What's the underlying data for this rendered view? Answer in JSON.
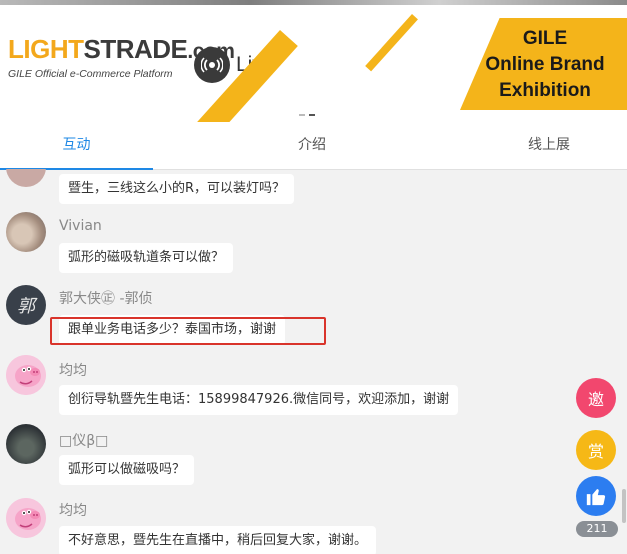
{
  "banner": {
    "logo_light": "LIGHT",
    "logo_strade": "STRADE",
    "logo_com": ".com",
    "logo_tagline": "GILE Official e-Commerce Platform",
    "live_label": "Live",
    "exhibition_lines": [
      "GILE",
      "Online Brand",
      "Exhibition"
    ]
  },
  "tabs": [
    {
      "label": "互动",
      "active": true
    },
    {
      "label": "介绍",
      "active": false
    },
    {
      "label": "线上展",
      "active": false
    }
  ],
  "messages": [
    {
      "name": "",
      "text": "暨生，三线这么小的R，可以装灯吗？"
    },
    {
      "name": "Vivian",
      "text": "弧形的磁吸轨道条可以做？"
    },
    {
      "name": "郭大侠㊣ -郭侦",
      "avatar_text": "郭",
      "text": "跟单业务电话多少？泰国市场，谢谢",
      "highlighted": true
    },
    {
      "name": "均均",
      "text": "创衍导轨暨先生电话：15899847926.微信同号，欢迎添加，谢谢"
    },
    {
      "name": "□仪β□",
      "text": "弧形可以做磁吸吗？"
    },
    {
      "name": "均均",
      "text": "不好意思，暨先生在直播中，稍后回复大家，谢谢。"
    }
  ],
  "float_buttons": {
    "invite_label": "邀",
    "reward_label": "赏",
    "like_icon": "thumbs-up-icon",
    "like_count": "211"
  },
  "colors": {
    "accent": "#1e88e5",
    "brand_yellow": "#f4b41a",
    "highlight_border": "#d9342b"
  }
}
